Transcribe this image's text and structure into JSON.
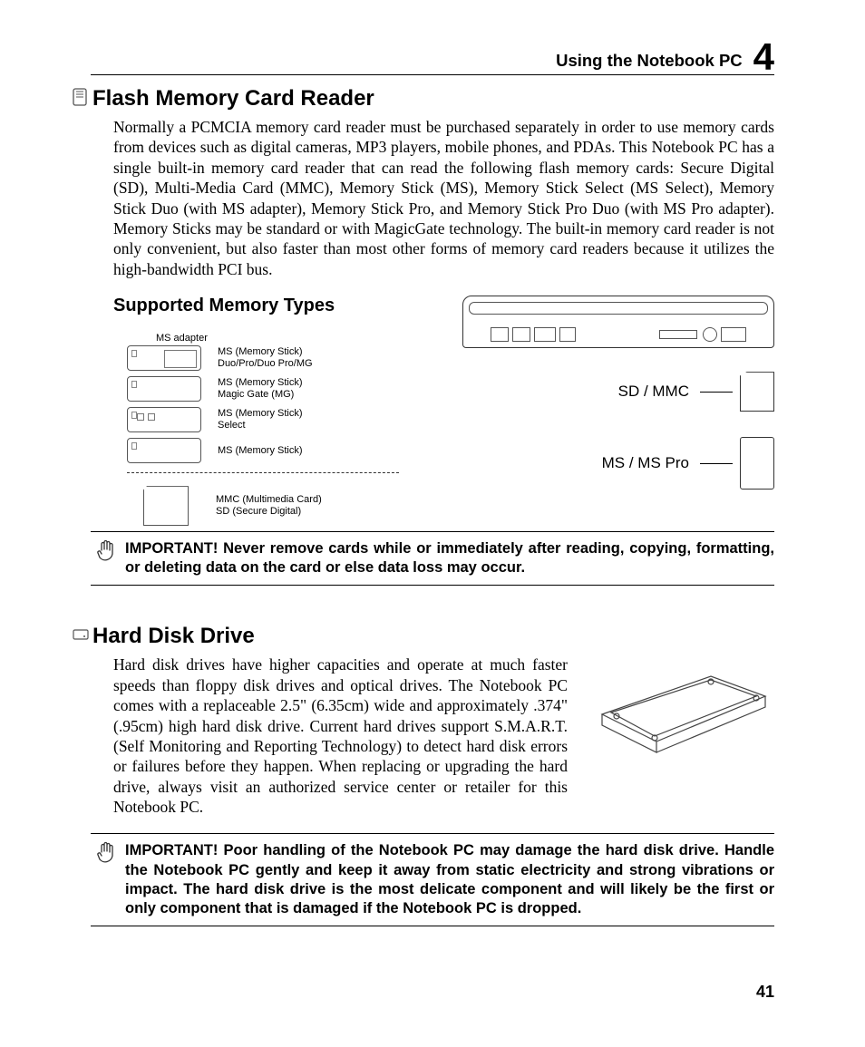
{
  "header": {
    "title": "Using the Notebook PC",
    "chapter": "4"
  },
  "section1": {
    "heading": "Flash Memory Card Reader",
    "body": "Normally a PCMCIA memory card reader must be purchased separately in order to use memory cards from devices such as digital cameras, MP3 players, mobile phones, and PDAs. This Notebook PC has a single built-in memory card reader that can read the following flash memory cards: Secure Digital (SD), Multi-Media Card (MMC), Memory Stick (MS), Memory Stick Select (MS Select), Memory Stick Duo (with MS adapter), Memory Stick Pro, and Memory Stick Pro Duo (with MS Pro adapter). Memory Sticks may be standard or with MagicGate technology. The built-in memory card reader is not only convenient, but also faster than most other forms of memory card readers because it utilizes the high-bandwidth PCI bus."
  },
  "subsection": "Supported Memory Types",
  "memtypes": {
    "adapter_label": "MS adapter",
    "cards": [
      {
        "label": "MS (Memory Stick)\nDuo/Pro/Duo Pro/MG"
      },
      {
        "label": "MS (Memory Stick)\nMagic Gate (MG)"
      },
      {
        "label": "MS (Memory Stick)\nSelect"
      },
      {
        "label": "MS (Memory Stick)"
      }
    ],
    "sd_label": "MMC (Multimedia Card)\nSD (Secure Digital)"
  },
  "slots": {
    "sd": "SD / MMC",
    "ms": "MS / MS Pro"
  },
  "important1": "IMPORTANT!  Never remove cards while or immediately after reading, copying, formatting, or deleting data on the card or else data loss may occur.",
  "section2": {
    "heading": "Hard Disk Drive",
    "body": "Hard disk drives have higher capacities and operate at much faster speeds than floppy disk drives and optical drives. The Notebook PC comes with a replaceable 2.5\" (6.35cm) wide and approximately .374\" (.95cm) high hard disk drive. Current hard drives support S.M.A.R.T. (Self Monitoring and Reporting Technology) to detect hard disk errors or failures before they happen. When replacing or upgrading the hard drive, always visit an authorized service center or retailer for this Notebook PC."
  },
  "important2": "IMPORTANT!  Poor handling of the Notebook PC may damage the hard disk drive. Handle the Notebook PC gently and keep it away from static electricity and strong vibrations or impact. The hard disk drive is the most delicate component and will likely be the first or only component that is damaged if the Notebook PC is dropped.",
  "page_number": "41"
}
